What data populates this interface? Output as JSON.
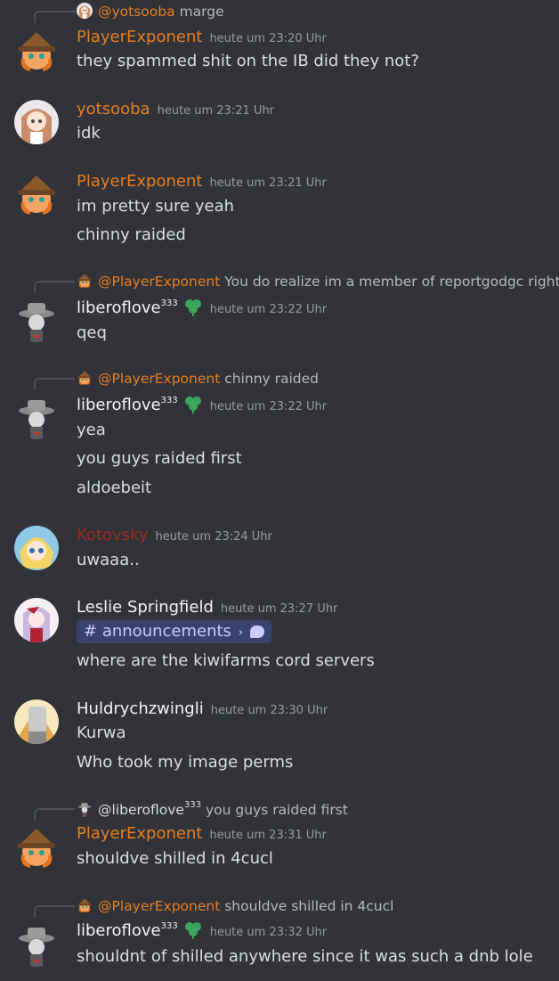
{
  "colors": {
    "background": "#313338",
    "player_exponent": "#e67e22",
    "yotsooba": "#e67e22",
    "kotovsky": "#992d22",
    "white_name": "#f2f3f5",
    "timestamp": "#949ba4",
    "channel_mention_bg": "#3c4270"
  },
  "messages": [
    {
      "reply": {
        "user": "@yotsooba",
        "text": "marge"
      },
      "author": "PlayerExponent",
      "time": "heute um 23:20 Uhr",
      "lines": [
        "they spammed shit on the IB did they not?"
      ]
    },
    {
      "author": "yotsooba",
      "time": "heute um 23:21 Uhr",
      "lines": [
        "idk"
      ]
    },
    {
      "author": "PlayerExponent",
      "time": "heute um 23:21 Uhr",
      "lines": [
        "im pretty sure yeah",
        "chinny raided"
      ]
    },
    {
      "reply": {
        "user": "@PlayerExponent",
        "text": "You do realize im a member of reportgodgc right"
      },
      "author": "liberoflove",
      "author_sup": "333",
      "time": "heute um 23:22 Uhr",
      "lines": [
        "qeq"
      ]
    },
    {
      "reply": {
        "user": "@PlayerExponent",
        "text": "chinny raided"
      },
      "author": "liberoflove",
      "author_sup": "333",
      "time": "heute um 23:22 Uhr",
      "lines": [
        "yea",
        "you guys raided first",
        "aldoebeit"
      ]
    },
    {
      "author": "Kotovsky",
      "time": "heute um 23:24 Uhr",
      "lines": [
        "uwaaa.."
      ]
    },
    {
      "author": "Leslie Springfield",
      "time": "heute um 23:27 Uhr",
      "channel_mention": "announcements",
      "channel_hash": "#",
      "channel_arrow": "›",
      "lines": [
        "where are the kiwifarms cord servers"
      ]
    },
    {
      "author": "Huldrychzwingli",
      "time": "heute um 23:30 Uhr",
      "lines": [
        "Kurwa",
        "Who took my image perms"
      ]
    },
    {
      "reply": {
        "user": "@liberoflove",
        "user_sup": "333",
        "text": "you guys raided first"
      },
      "author": "PlayerExponent",
      "time": "heute um 23:31 Uhr",
      "lines": [
        "shouldve shilled in 4cucl"
      ]
    },
    {
      "reply": {
        "user": "@PlayerExponent",
        "text": "shouldve shilled in 4cucl"
      },
      "author": "liberoflove",
      "author_sup": "333",
      "time": "heute um 23:32 Uhr",
      "lines": [
        "shouldnt of shilled anywhere since it was such a dnb lole"
      ]
    }
  ]
}
